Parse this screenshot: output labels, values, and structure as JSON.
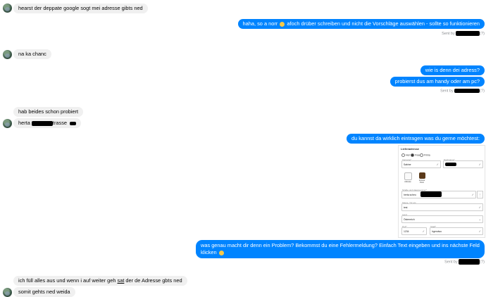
{
  "messages": [
    {
      "dir": "in",
      "text": "hearst der deppate google sogt mei adresse gibts ned"
    },
    {
      "dir": "out",
      "text_a": "haha, so a norr",
      "text_b": "afoch drüber schreiben und nicht die Vorschläge auswählen - sollte so funktionieren"
    },
    {
      "dir": "in",
      "text": "na ka chanc"
    },
    {
      "dir": "out",
      "text": "wie is denn dei adress?"
    },
    {
      "dir": "out",
      "text": "probierst dus am handy oder am pc?"
    },
    {
      "dir": "in",
      "text": "hab beides schon probiert"
    },
    {
      "dir": "in",
      "text_a": "herta",
      "text_b": "trasse"
    },
    {
      "dir": "out",
      "text": "du kannst da wirklich eintragen was du gerne möchtest:"
    },
    {
      "dir": "out",
      "text": "was genau macht dir denn ein Problem? Bekommst du eine Fehlermeldung? Einfach Text eingeben und ins nächste Feld klicken"
    },
    {
      "dir": "in",
      "text_a": "ich füll alles aus und wenn i auf weiter geh ",
      "text_u": "sat",
      "text_b": " der de Adresse gbts ned"
    },
    {
      "dir": "in",
      "text": "somit gehts ned weida"
    }
  ],
  "receipts": {
    "sent_by": "Sent by",
    "suffix": "(?)"
  },
  "embedded_form": {
    "title": "Lieferadresse",
    "salutations": [
      "Herr",
      "Frau",
      "Firma"
    ],
    "selected_salutation": "Frau",
    "firstname_label": "Vorname*",
    "firstname_value": "Sabine",
    "lastname_label": "Nachname*",
    "options": [
      "Adresse",
      "Access Point"
    ],
    "street_label": "Straße und Hausnummer*",
    "street_value": "herta scheu",
    "door_label": "Stiege, Tür etc.",
    "door_value": "test",
    "country_label": "Land",
    "country_value": "Österreich",
    "zip_label": "PLZ*",
    "zip_value": "1234",
    "city_label": "Stadt*",
    "city_value": "Irgendwo"
  },
  "colors": {
    "outgoing": "#0084ff",
    "incoming": "#f0f0f0",
    "meta": "#8a8d91"
  },
  "icons": [
    "avatar",
    "smile-emoji-icon",
    "check-icon",
    "ups-logo-icon"
  ]
}
